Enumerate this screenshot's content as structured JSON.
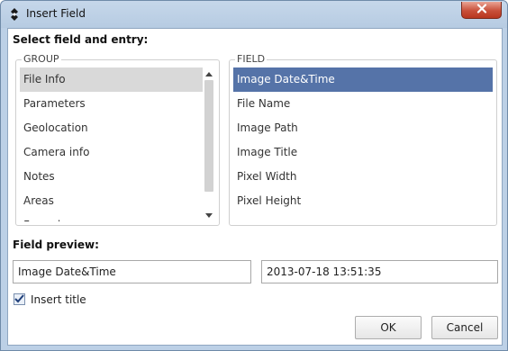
{
  "window": {
    "title": "Insert Field"
  },
  "labels": {
    "select_field": "Select field and entry:",
    "field_preview": "Field preview:"
  },
  "group": {
    "title": "GROUP",
    "items": [
      "File Info",
      "Parameters",
      "Geolocation",
      "Camera info",
      "Notes",
      "Areas",
      "Formulas"
    ],
    "selected": "File Info"
  },
  "field": {
    "title": "FIELD",
    "items": [
      "Image Date&Time",
      "File Name",
      "Image Path",
      "Image Title",
      "Pixel Width",
      "Pixel Height"
    ],
    "selected": "Image Date&Time"
  },
  "preview": {
    "name_value": "Image Date&Time",
    "value_value": "2013-07-18 13:51:35"
  },
  "insert_title": {
    "label": "Insert title",
    "checked": true
  },
  "buttons": {
    "ok": "OK",
    "cancel": "Cancel"
  },
  "icons": {
    "app": "app-logo-icon",
    "close": "close-icon",
    "scroll_up": "scroll-up-arrow-icon",
    "scroll_down": "scroll-down-arrow-icon",
    "check": "checkmark-icon"
  },
  "colors": {
    "selection_blue": "#5573a8",
    "selection_gray": "#d9d9d9",
    "close_red": "#c8503a",
    "title_bar": "#bcd0e6"
  }
}
